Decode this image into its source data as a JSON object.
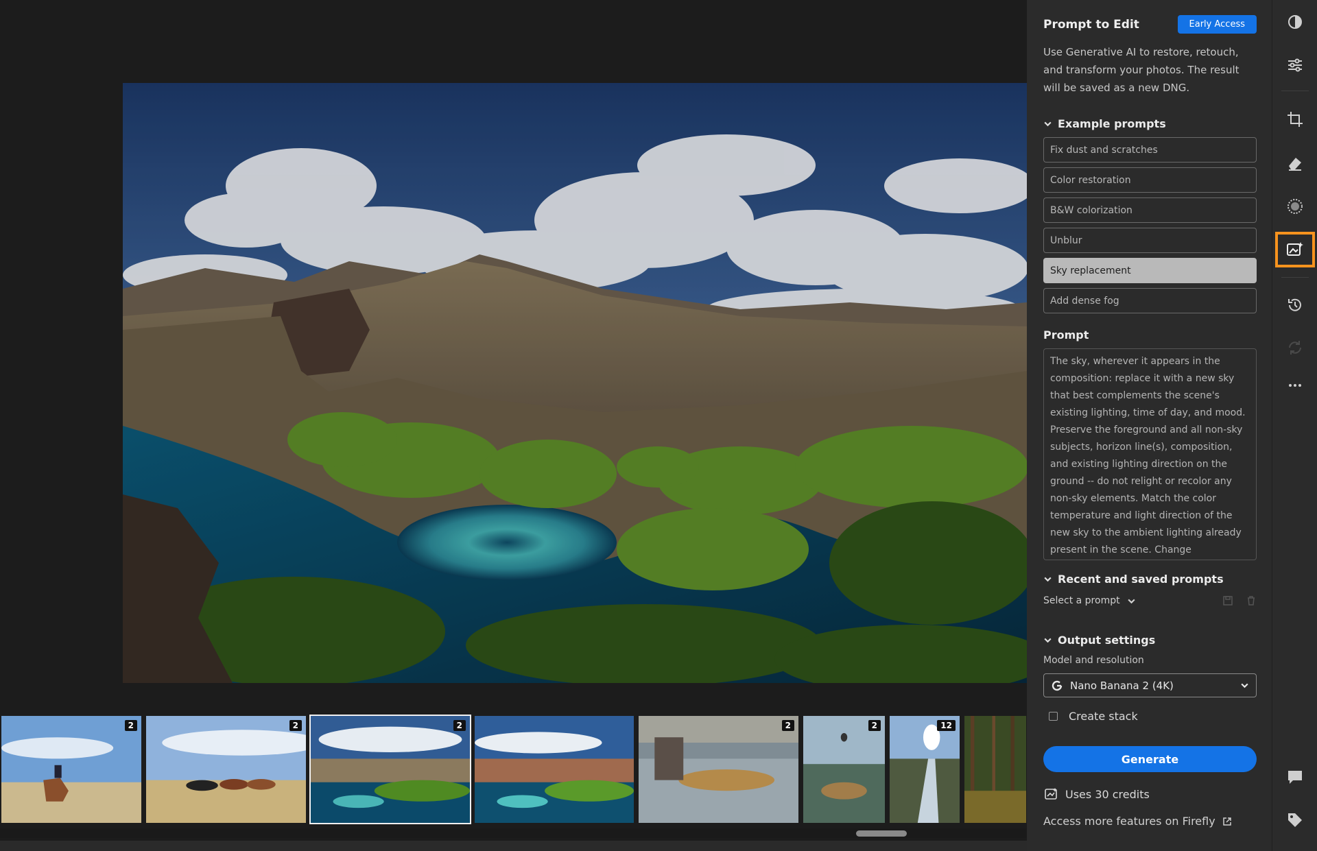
{
  "panel": {
    "title": "Prompt to Edit",
    "badge": "Early Access",
    "description": "Use Generative AI to restore, retouch, and transform your photos. The result will be saved as a new DNG.",
    "examples_heading": "Example prompts",
    "examples": [
      "Fix dust and scratches",
      "Color restoration",
      "B&W colorization",
      "Unblur",
      "Sky replacement",
      "Add dense fog"
    ],
    "active_example": "Sky replacement",
    "prompt_label": "Prompt",
    "prompt_text": "The sky, wherever it appears in the composition: replace it with a new sky that best complements the scene's existing lighting, time of day, and mood. Preserve the foreground and all non-sky subjects, horizon line(s), composition, and existing lighting direction on the ground -- do not relight or recolor any non-sky elements. Match the color temperature and light direction of the new sky to the ambient lighting already present in the scene. Change moderately. No added objects, no altered subject identity, no",
    "recent_heading": "Recent and saved prompts",
    "select_prompt": "Select a prompt",
    "output_heading": "Output settings",
    "model_label": "Model and resolution",
    "model_value": "Nano Banana 2 (4K)",
    "create_stack": "Create stack",
    "generate": "Generate",
    "credits": "Uses 30 credits",
    "firefly_link": "Access more features on Firefly"
  },
  "filmstrip": {
    "thumbs": [
      {
        "scene": "rider-plain",
        "badge": "2"
      },
      {
        "scene": "horses-herd",
        "badge": "2"
      },
      {
        "scene": "lagoon",
        "badge": "2",
        "selected": true
      },
      {
        "scene": "lagoon-warm",
        "badge": ""
      },
      {
        "scene": "trout-hands",
        "badge": "2"
      },
      {
        "scene": "underwater-fish",
        "badge": "2"
      },
      {
        "scene": "river-sun",
        "badge": "12"
      },
      {
        "scene": "forest",
        "badge": ""
      }
    ]
  },
  "toolbar": {
    "icons": [
      "edit-presets-icon",
      "adjust-sliders-icon",
      "crop-icon",
      "eraser-icon",
      "masking-icon",
      "prompt-to-edit-icon",
      "history-icon",
      "sync-icon",
      "more-icon",
      "comments-icon",
      "tag-icon"
    ],
    "active": "prompt-to-edit-icon"
  },
  "colors": {
    "accent": "#1473e6",
    "highlight": "#f7931e"
  }
}
